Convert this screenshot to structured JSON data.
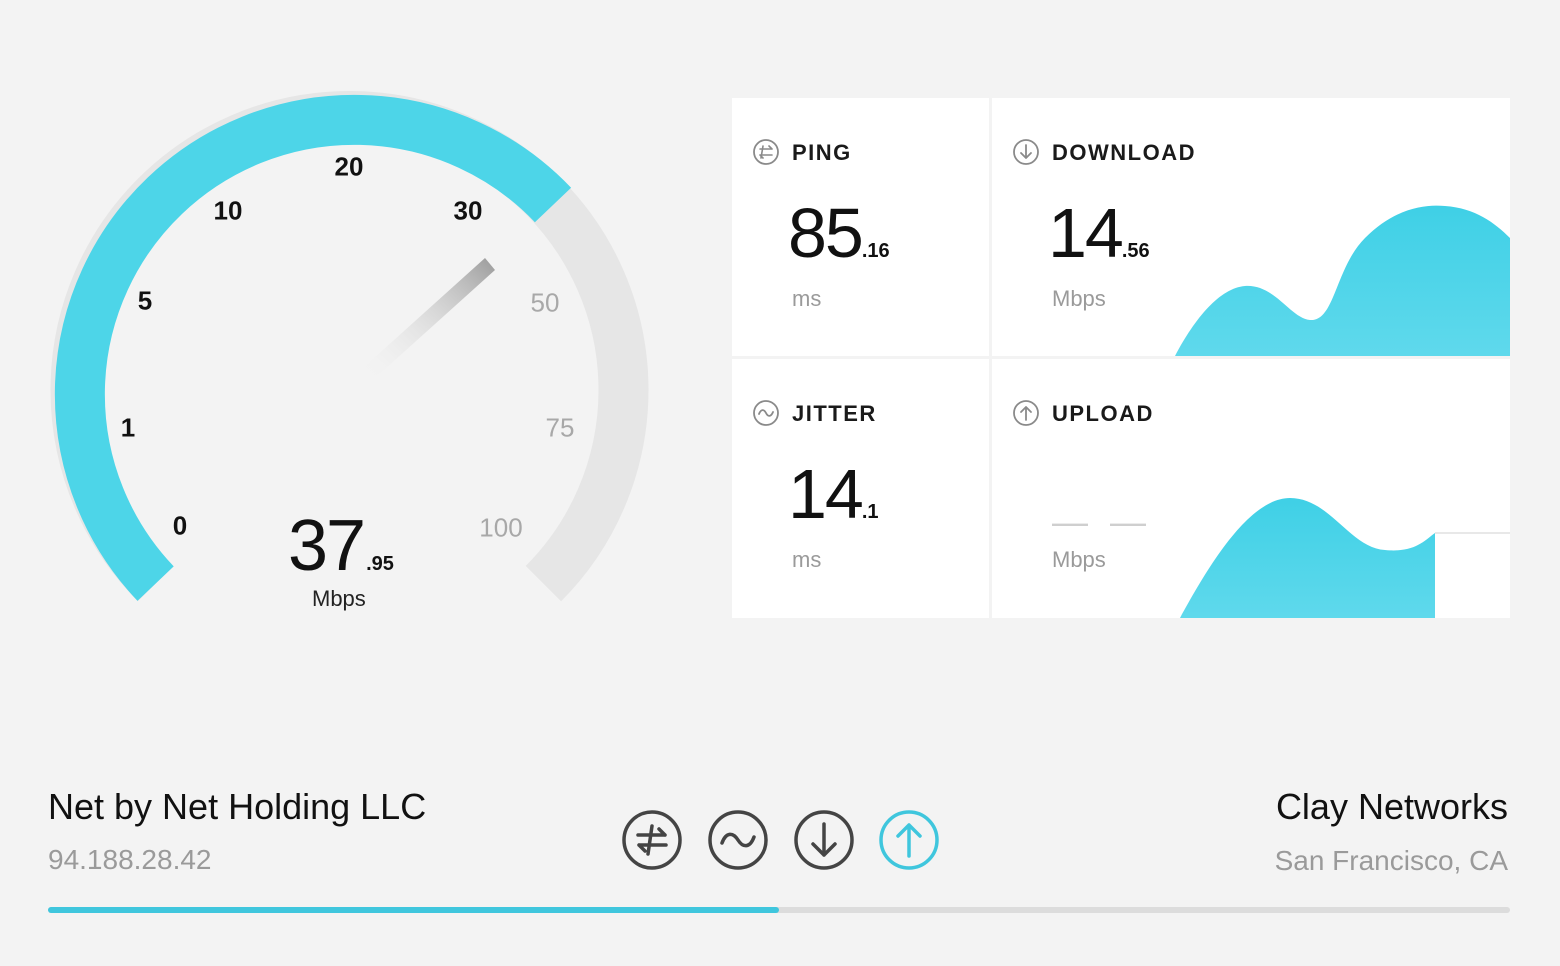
{
  "colors": {
    "accent": "#4dd5e8",
    "text": "#111111",
    "muted": "#9a9a9a",
    "track": "#e6e6e6",
    "card": "#ffffff"
  },
  "gauge": {
    "value_int": "37",
    "value_dec": ".95",
    "unit": "Mbps",
    "ticks": [
      "0",
      "1",
      "5",
      "10",
      "20",
      "30",
      "50",
      "75",
      "100"
    ]
  },
  "metrics": {
    "ping": {
      "label": "PING",
      "value_int": "85",
      "value_dec": ".16",
      "unit": "ms",
      "icon": "ping-icon"
    },
    "jitter": {
      "label": "JITTER",
      "value_int": "14",
      "value_dec": ".1",
      "unit": "ms",
      "icon": "jitter-icon"
    },
    "download": {
      "label": "DOWNLOAD",
      "value_int": "14",
      "value_dec": ".56",
      "unit": "Mbps",
      "icon": "download-icon"
    },
    "upload": {
      "label": "UPLOAD",
      "value": "— —",
      "unit": "Mbps",
      "icon": "upload-icon"
    }
  },
  "isp": {
    "name": "Net by Net Holding LLC",
    "ip": "94.188.28.42"
  },
  "server": {
    "name": "Clay Networks",
    "location": "San Francisco, CA"
  },
  "stages": [
    "ping-icon",
    "jitter-icon",
    "download-icon",
    "upload-icon"
  ],
  "progress": 0.5
}
